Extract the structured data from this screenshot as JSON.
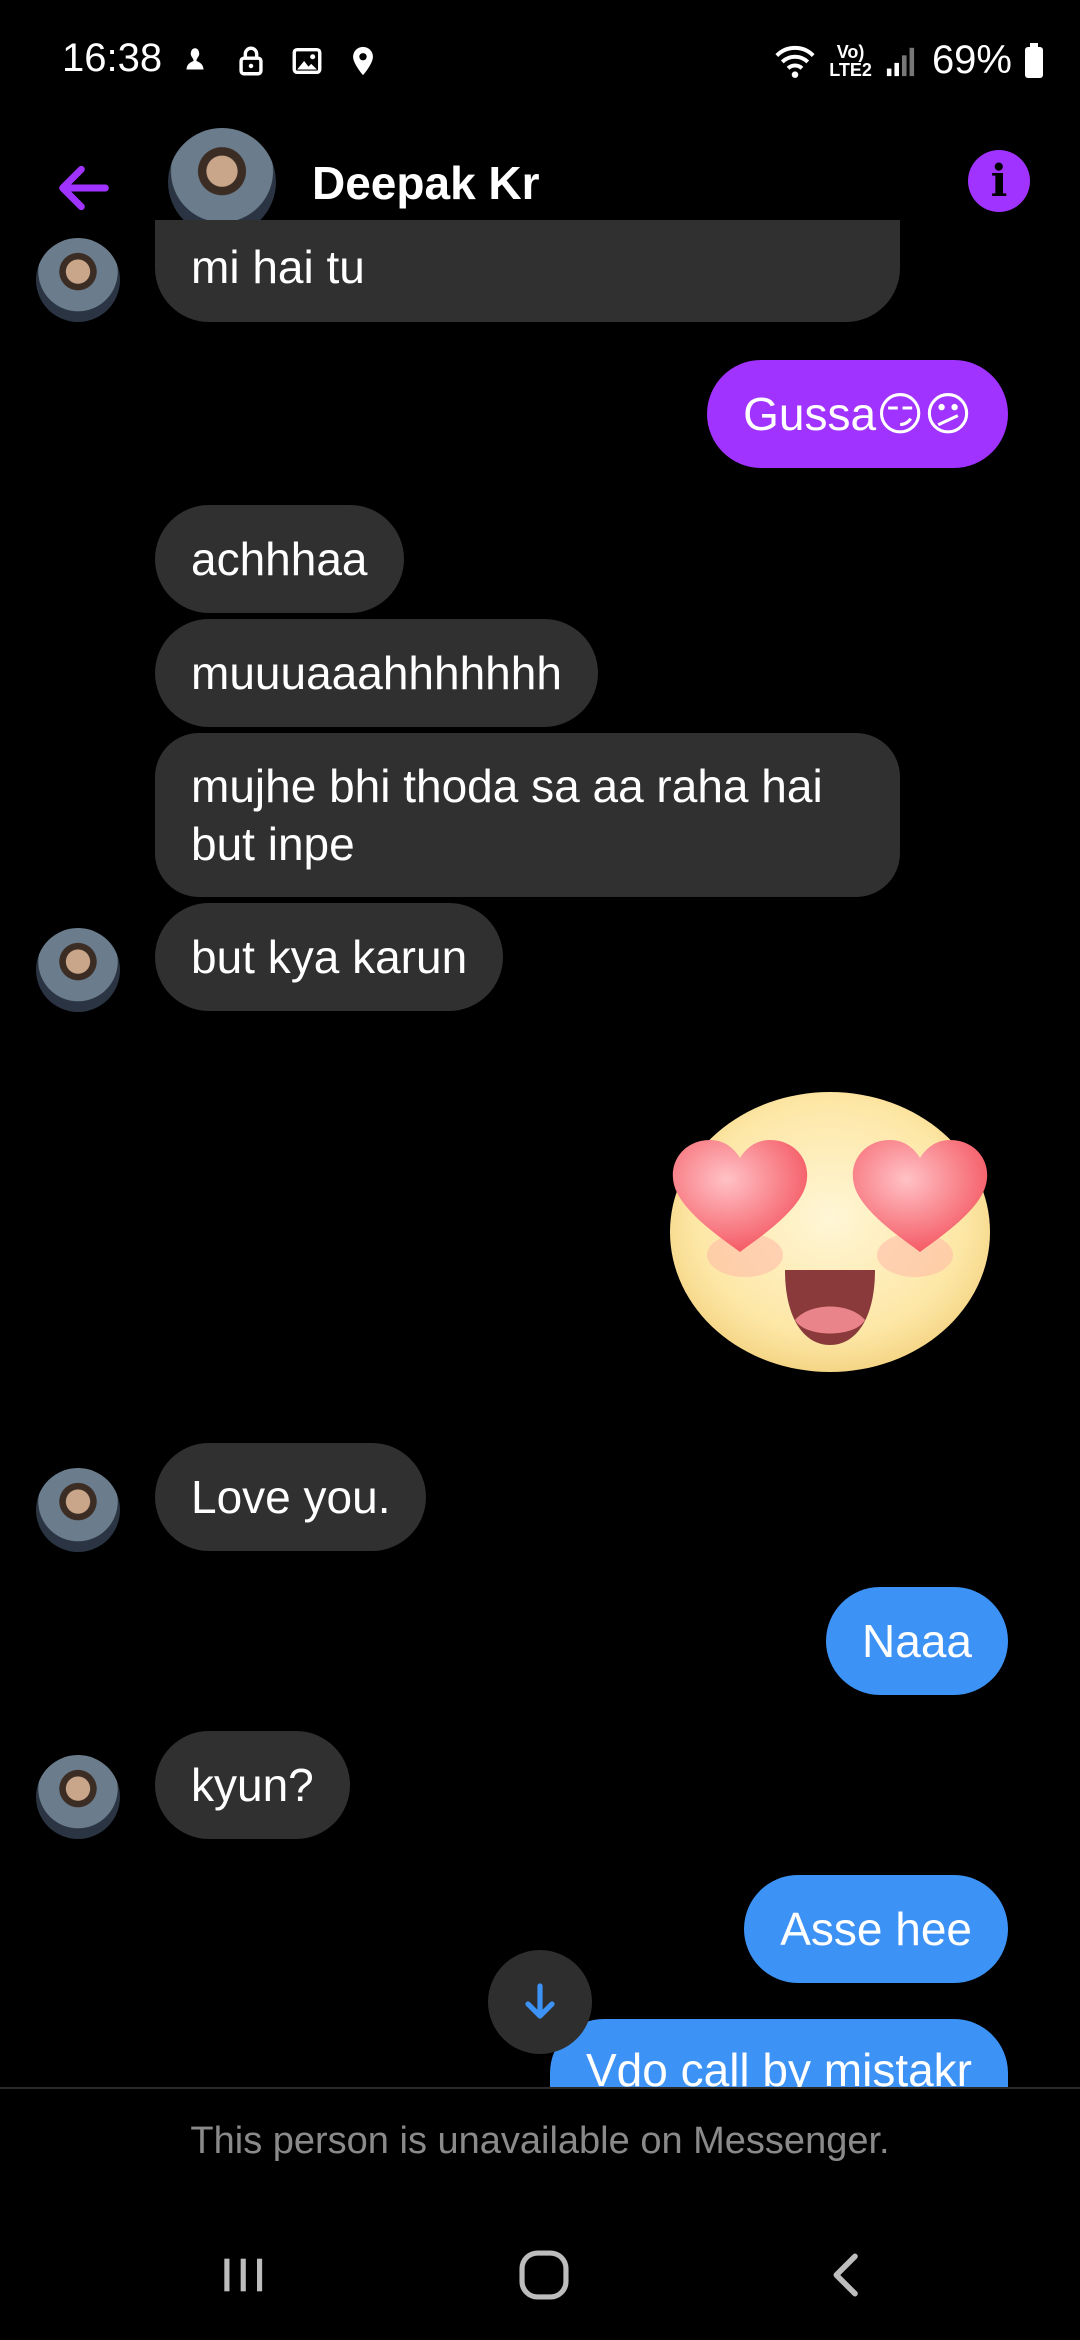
{
  "status_bar": {
    "time": "16:38",
    "battery": "69%",
    "network_tag_top": "Vo)",
    "network_tag_bottom": "LTE2",
    "icons": [
      "notification-icon",
      "lock-icon",
      "gallery-icon",
      "location-icon",
      "wifi-icon",
      "signal-icon",
      "battery-icon"
    ]
  },
  "header": {
    "contact_name": "Deepak Kr",
    "info_label": "i"
  },
  "messages": [
    {
      "side": "in",
      "text": "mi hai tu"
    },
    {
      "side": "out",
      "text": "Gussa😏😕"
    },
    {
      "side": "in",
      "text": "achhhaa"
    },
    {
      "side": "in",
      "text": "muuuaaahhhhhhh"
    },
    {
      "side": "in",
      "text": "mujhe bhi thoda sa aa raha hai but inpe"
    },
    {
      "side": "in",
      "text": "but kya karun"
    },
    {
      "side": "out",
      "sticker": "heart-eyes-emoji"
    },
    {
      "side": "in",
      "text": "Love you."
    },
    {
      "side": "out",
      "text": "Naaa"
    },
    {
      "side": "in",
      "text": "kyun?"
    },
    {
      "side": "out",
      "text": "Asse hee"
    },
    {
      "side": "out",
      "text": "Vdo call by mistakr"
    }
  ],
  "footer": {
    "notice": "This person is unavailable on Messenger."
  },
  "colors": {
    "accent": "#a033ff",
    "outgoing_blue": "#3d92f5",
    "incoming_bubble": "#303030",
    "background": "#000000"
  }
}
